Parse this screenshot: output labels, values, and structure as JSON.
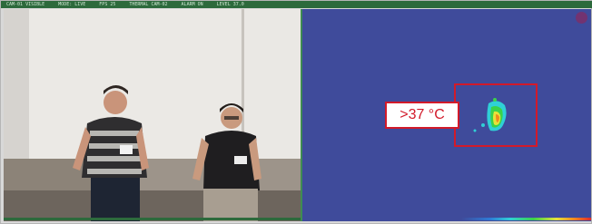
{
  "status_bar": {
    "segments": [
      "CAM-01 VISIBLE",
      "MODE: LIVE",
      "FPS 25",
      "THERMAL CAM-02",
      "ALARM ON",
      "LEVEL 37.0"
    ]
  },
  "thermal": {
    "alert_label": ">37 °C"
  },
  "colors": {
    "frame_green": "#2d6a3c",
    "thermal_background": "#3f4b9b",
    "alert_red": "#d21a2a"
  }
}
